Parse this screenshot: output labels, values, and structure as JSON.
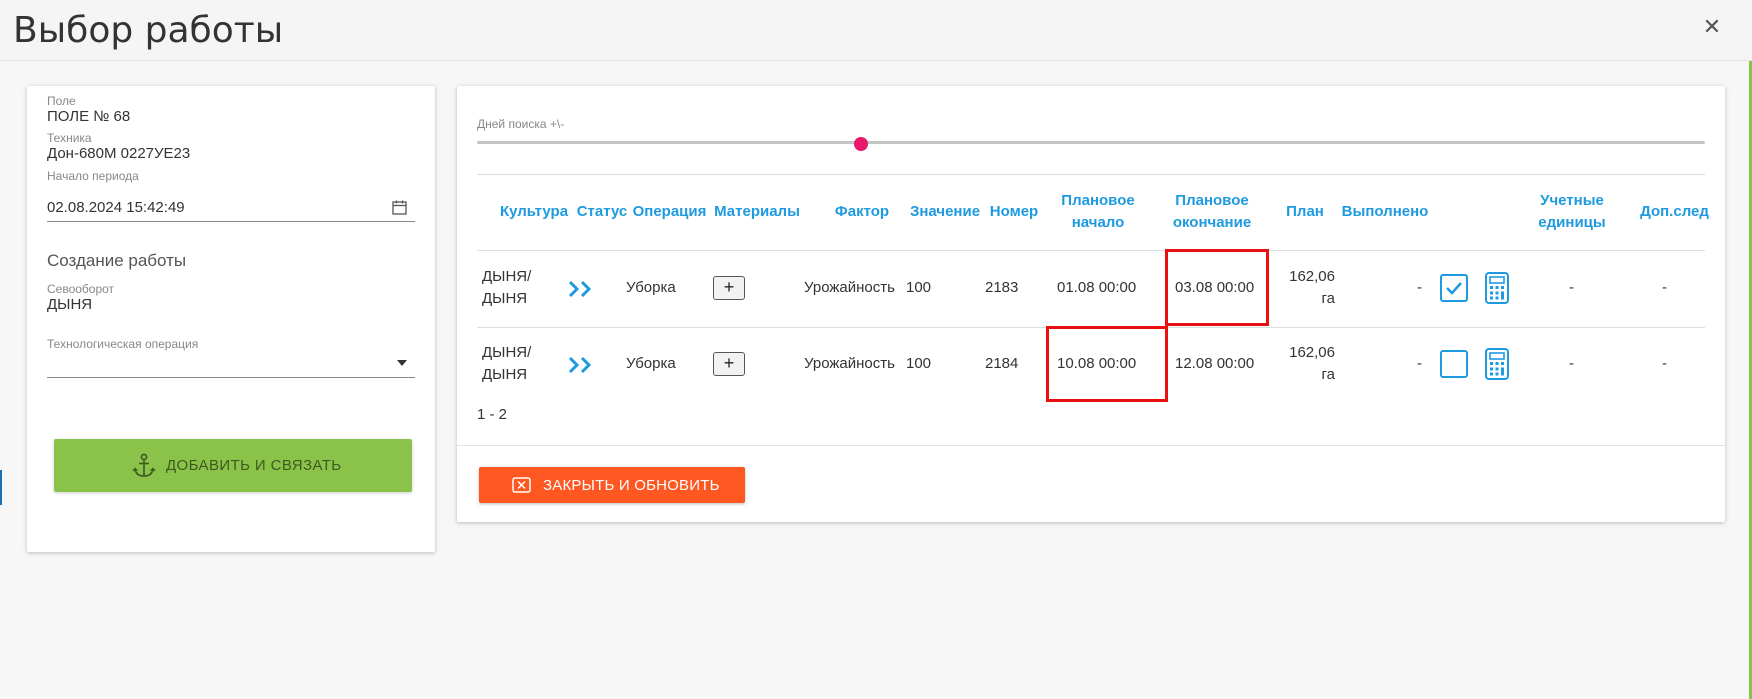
{
  "modal": {
    "title": "Выбор работы",
    "close_icon": "close-icon"
  },
  "left_panel": {
    "field_label": "Поле",
    "field_value": "ПОЛЕ № 68",
    "machine_label": "Техника",
    "machine_value": "Дон-680М 0227УЕ23",
    "period_label": "Начало периода",
    "period_value": "02.08.2024 15:42:49",
    "section_title": "Создание работы",
    "rotation_label": "Севооборот",
    "rotation_value": "ДЫНЯ",
    "operation_label": "Технологическая операция",
    "operation_value": "",
    "add_button": "ДОБАВИТЬ И СВЯЗАТЬ",
    "add_button_icon": "anchor-icon"
  },
  "right_panel": {
    "slider_label": "Дней поиска +\\-",
    "slider_value_fraction": 0.31,
    "columns": [
      "Культура",
      "Статус",
      "Операция",
      "Материалы",
      "Фактор",
      "Значение",
      "Номер",
      "Плановое начало",
      "Плановое окончание",
      "План",
      "Выполнено",
      "",
      "Учетные единицы",
      "Доп.след"
    ],
    "rows": [
      {
        "culture": "ДЫНЯ/ ДЫНЯ",
        "status_icon": "double-chevron-right-icon",
        "operation": "Уборка",
        "materials": "+",
        "factor": "Урожайность",
        "value": "100",
        "number": "2183",
        "plan_start": "01.08 00:00",
        "plan_end": "03.08 00:00",
        "plan": "162,06 га",
        "done": "-",
        "checked": true,
        "units": "-",
        "extra": "-"
      },
      {
        "culture": "ДЫНЯ/ ДЫНЯ",
        "status_icon": "double-chevron-right-icon",
        "operation": "Уборка",
        "materials": "+",
        "factor": "Урожайность",
        "value": "100",
        "number": "2184",
        "plan_start": "10.08 00:00",
        "plan_end": "12.08 00:00",
        "plan": "162,06 га",
        "done": "-",
        "checked": false,
        "units": "-",
        "extra": "-"
      }
    ],
    "pager": "1 - 2",
    "close_button": "ЗАКРЫТЬ И ОБНОВИТЬ",
    "close_button_icon": "close-box-icon"
  },
  "colors": {
    "accent_blue": "#1e9ae0",
    "green_button": "#8bc34a",
    "orange_button": "#ff5722",
    "slider_thumb": "#e6196b",
    "highlight_red": "#e81010"
  }
}
